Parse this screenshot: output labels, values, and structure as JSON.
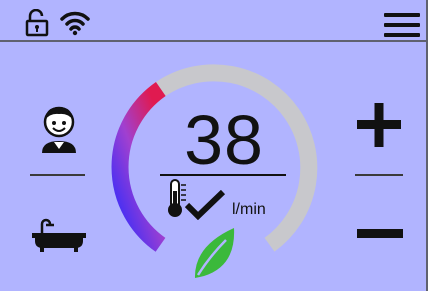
{
  "status_bar": {
    "lock_icon": "unlocked-padlock-icon",
    "wifi_icon": "wifi-icon",
    "menu_icon": "hamburger-menu-icon"
  },
  "flow": {
    "value": "38",
    "unit": "l/min",
    "level_fraction": 0.38
  },
  "left_panel": {
    "user_icon": "child-face-icon",
    "bath_icon": "bathtub-icon"
  },
  "right_panel": {
    "plus_icon": "plus-icon",
    "minus_icon": "minus-icon"
  },
  "indicators": {
    "thermometer_icon": "thermometer-icon",
    "check_icon": "checkmark-icon",
    "leaf_icon": "eco-leaf-icon"
  },
  "colors": {
    "background": "#b1b4ff",
    "gauge_track": "#c8c8cc",
    "gauge_start": "#2a2aff",
    "gauge_mid": "#a040d0",
    "gauge_end": "#e01a50",
    "leaf": "#3bb93b"
  }
}
